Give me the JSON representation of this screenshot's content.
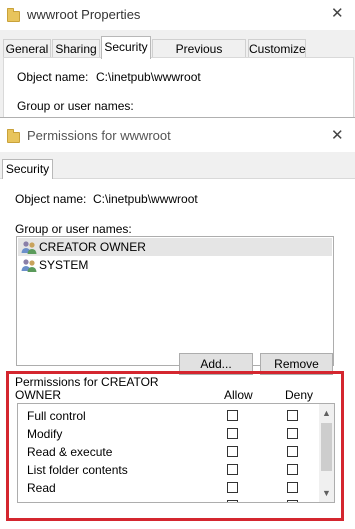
{
  "background_window": {
    "title": "wwwroot Properties",
    "close_glyph": "✕",
    "tabs": [
      "General",
      "Sharing",
      "Security",
      "Previous Versions",
      "Customize"
    ],
    "selected_tab": "Security",
    "object_name_label": "Object name:",
    "object_name_value": "C:\\inetpub\\wwwroot",
    "group_label": "Group or user names:"
  },
  "dialog": {
    "title": "Permissions for wwwroot",
    "close_glyph": "✕",
    "tab": "Security",
    "object_name_label": "Object name:",
    "object_name_value": "C:\\inetpub\\wwwroot",
    "group_label": "Group or user names:",
    "users": [
      {
        "name": "CREATOR OWNER",
        "selected": true
      },
      {
        "name": "SYSTEM",
        "selected": false
      }
    ],
    "add_button": "Add...",
    "remove_button": "Remove",
    "permissions_label_line1": "Permissions for CREATOR",
    "permissions_label_line2": "OWNER",
    "allow_header": "Allow",
    "deny_header": "Deny",
    "permissions": [
      {
        "name": "Full control",
        "allow": false,
        "deny": false
      },
      {
        "name": "Modify",
        "allow": false,
        "deny": false
      },
      {
        "name": "Read & execute",
        "allow": false,
        "deny": false
      },
      {
        "name": "List folder contents",
        "allow": false,
        "deny": false
      },
      {
        "name": "Read",
        "allow": false,
        "deny": false
      }
    ],
    "scroll_up_glyph": "▲",
    "scroll_down_glyph": "▼"
  },
  "colors": {
    "highlight": "#d4262f",
    "selected_row": "#e5e5e5"
  }
}
